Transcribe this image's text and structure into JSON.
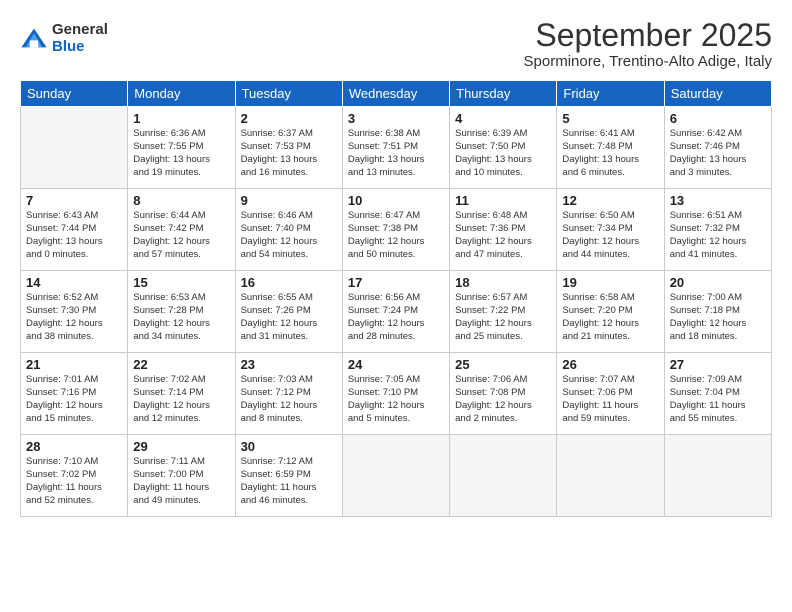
{
  "logo": {
    "general": "General",
    "blue": "Blue"
  },
  "title": "September 2025",
  "location": "Sporminore, Trentino-Alto Adige, Italy",
  "weekdays": [
    "Sunday",
    "Monday",
    "Tuesday",
    "Wednesday",
    "Thursday",
    "Friday",
    "Saturday"
  ],
  "weeks": [
    [
      {
        "day": "",
        "info": ""
      },
      {
        "day": "1",
        "info": "Sunrise: 6:36 AM\nSunset: 7:55 PM\nDaylight: 13 hours\nand 19 minutes."
      },
      {
        "day": "2",
        "info": "Sunrise: 6:37 AM\nSunset: 7:53 PM\nDaylight: 13 hours\nand 16 minutes."
      },
      {
        "day": "3",
        "info": "Sunrise: 6:38 AM\nSunset: 7:51 PM\nDaylight: 13 hours\nand 13 minutes."
      },
      {
        "day": "4",
        "info": "Sunrise: 6:39 AM\nSunset: 7:50 PM\nDaylight: 13 hours\nand 10 minutes."
      },
      {
        "day": "5",
        "info": "Sunrise: 6:41 AM\nSunset: 7:48 PM\nDaylight: 13 hours\nand 6 minutes."
      },
      {
        "day": "6",
        "info": "Sunrise: 6:42 AM\nSunset: 7:46 PM\nDaylight: 13 hours\nand 3 minutes."
      }
    ],
    [
      {
        "day": "7",
        "info": "Sunrise: 6:43 AM\nSunset: 7:44 PM\nDaylight: 13 hours\nand 0 minutes."
      },
      {
        "day": "8",
        "info": "Sunrise: 6:44 AM\nSunset: 7:42 PM\nDaylight: 12 hours\nand 57 minutes."
      },
      {
        "day": "9",
        "info": "Sunrise: 6:46 AM\nSunset: 7:40 PM\nDaylight: 12 hours\nand 54 minutes."
      },
      {
        "day": "10",
        "info": "Sunrise: 6:47 AM\nSunset: 7:38 PM\nDaylight: 12 hours\nand 50 minutes."
      },
      {
        "day": "11",
        "info": "Sunrise: 6:48 AM\nSunset: 7:36 PM\nDaylight: 12 hours\nand 47 minutes."
      },
      {
        "day": "12",
        "info": "Sunrise: 6:50 AM\nSunset: 7:34 PM\nDaylight: 12 hours\nand 44 minutes."
      },
      {
        "day": "13",
        "info": "Sunrise: 6:51 AM\nSunset: 7:32 PM\nDaylight: 12 hours\nand 41 minutes."
      }
    ],
    [
      {
        "day": "14",
        "info": "Sunrise: 6:52 AM\nSunset: 7:30 PM\nDaylight: 12 hours\nand 38 minutes."
      },
      {
        "day": "15",
        "info": "Sunrise: 6:53 AM\nSunset: 7:28 PM\nDaylight: 12 hours\nand 34 minutes."
      },
      {
        "day": "16",
        "info": "Sunrise: 6:55 AM\nSunset: 7:26 PM\nDaylight: 12 hours\nand 31 minutes."
      },
      {
        "day": "17",
        "info": "Sunrise: 6:56 AM\nSunset: 7:24 PM\nDaylight: 12 hours\nand 28 minutes."
      },
      {
        "day": "18",
        "info": "Sunrise: 6:57 AM\nSunset: 7:22 PM\nDaylight: 12 hours\nand 25 minutes."
      },
      {
        "day": "19",
        "info": "Sunrise: 6:58 AM\nSunset: 7:20 PM\nDaylight: 12 hours\nand 21 minutes."
      },
      {
        "day": "20",
        "info": "Sunrise: 7:00 AM\nSunset: 7:18 PM\nDaylight: 12 hours\nand 18 minutes."
      }
    ],
    [
      {
        "day": "21",
        "info": "Sunrise: 7:01 AM\nSunset: 7:16 PM\nDaylight: 12 hours\nand 15 minutes."
      },
      {
        "day": "22",
        "info": "Sunrise: 7:02 AM\nSunset: 7:14 PM\nDaylight: 12 hours\nand 12 minutes."
      },
      {
        "day": "23",
        "info": "Sunrise: 7:03 AM\nSunset: 7:12 PM\nDaylight: 12 hours\nand 8 minutes."
      },
      {
        "day": "24",
        "info": "Sunrise: 7:05 AM\nSunset: 7:10 PM\nDaylight: 12 hours\nand 5 minutes."
      },
      {
        "day": "25",
        "info": "Sunrise: 7:06 AM\nSunset: 7:08 PM\nDaylight: 12 hours\nand 2 minutes."
      },
      {
        "day": "26",
        "info": "Sunrise: 7:07 AM\nSunset: 7:06 PM\nDaylight: 11 hours\nand 59 minutes."
      },
      {
        "day": "27",
        "info": "Sunrise: 7:09 AM\nSunset: 7:04 PM\nDaylight: 11 hours\nand 55 minutes."
      }
    ],
    [
      {
        "day": "28",
        "info": "Sunrise: 7:10 AM\nSunset: 7:02 PM\nDaylight: 11 hours\nand 52 minutes."
      },
      {
        "day": "29",
        "info": "Sunrise: 7:11 AM\nSunset: 7:00 PM\nDaylight: 11 hours\nand 49 minutes."
      },
      {
        "day": "30",
        "info": "Sunrise: 7:12 AM\nSunset: 6:59 PM\nDaylight: 11 hours\nand 46 minutes."
      },
      {
        "day": "",
        "info": ""
      },
      {
        "day": "",
        "info": ""
      },
      {
        "day": "",
        "info": ""
      },
      {
        "day": "",
        "info": ""
      }
    ]
  ]
}
